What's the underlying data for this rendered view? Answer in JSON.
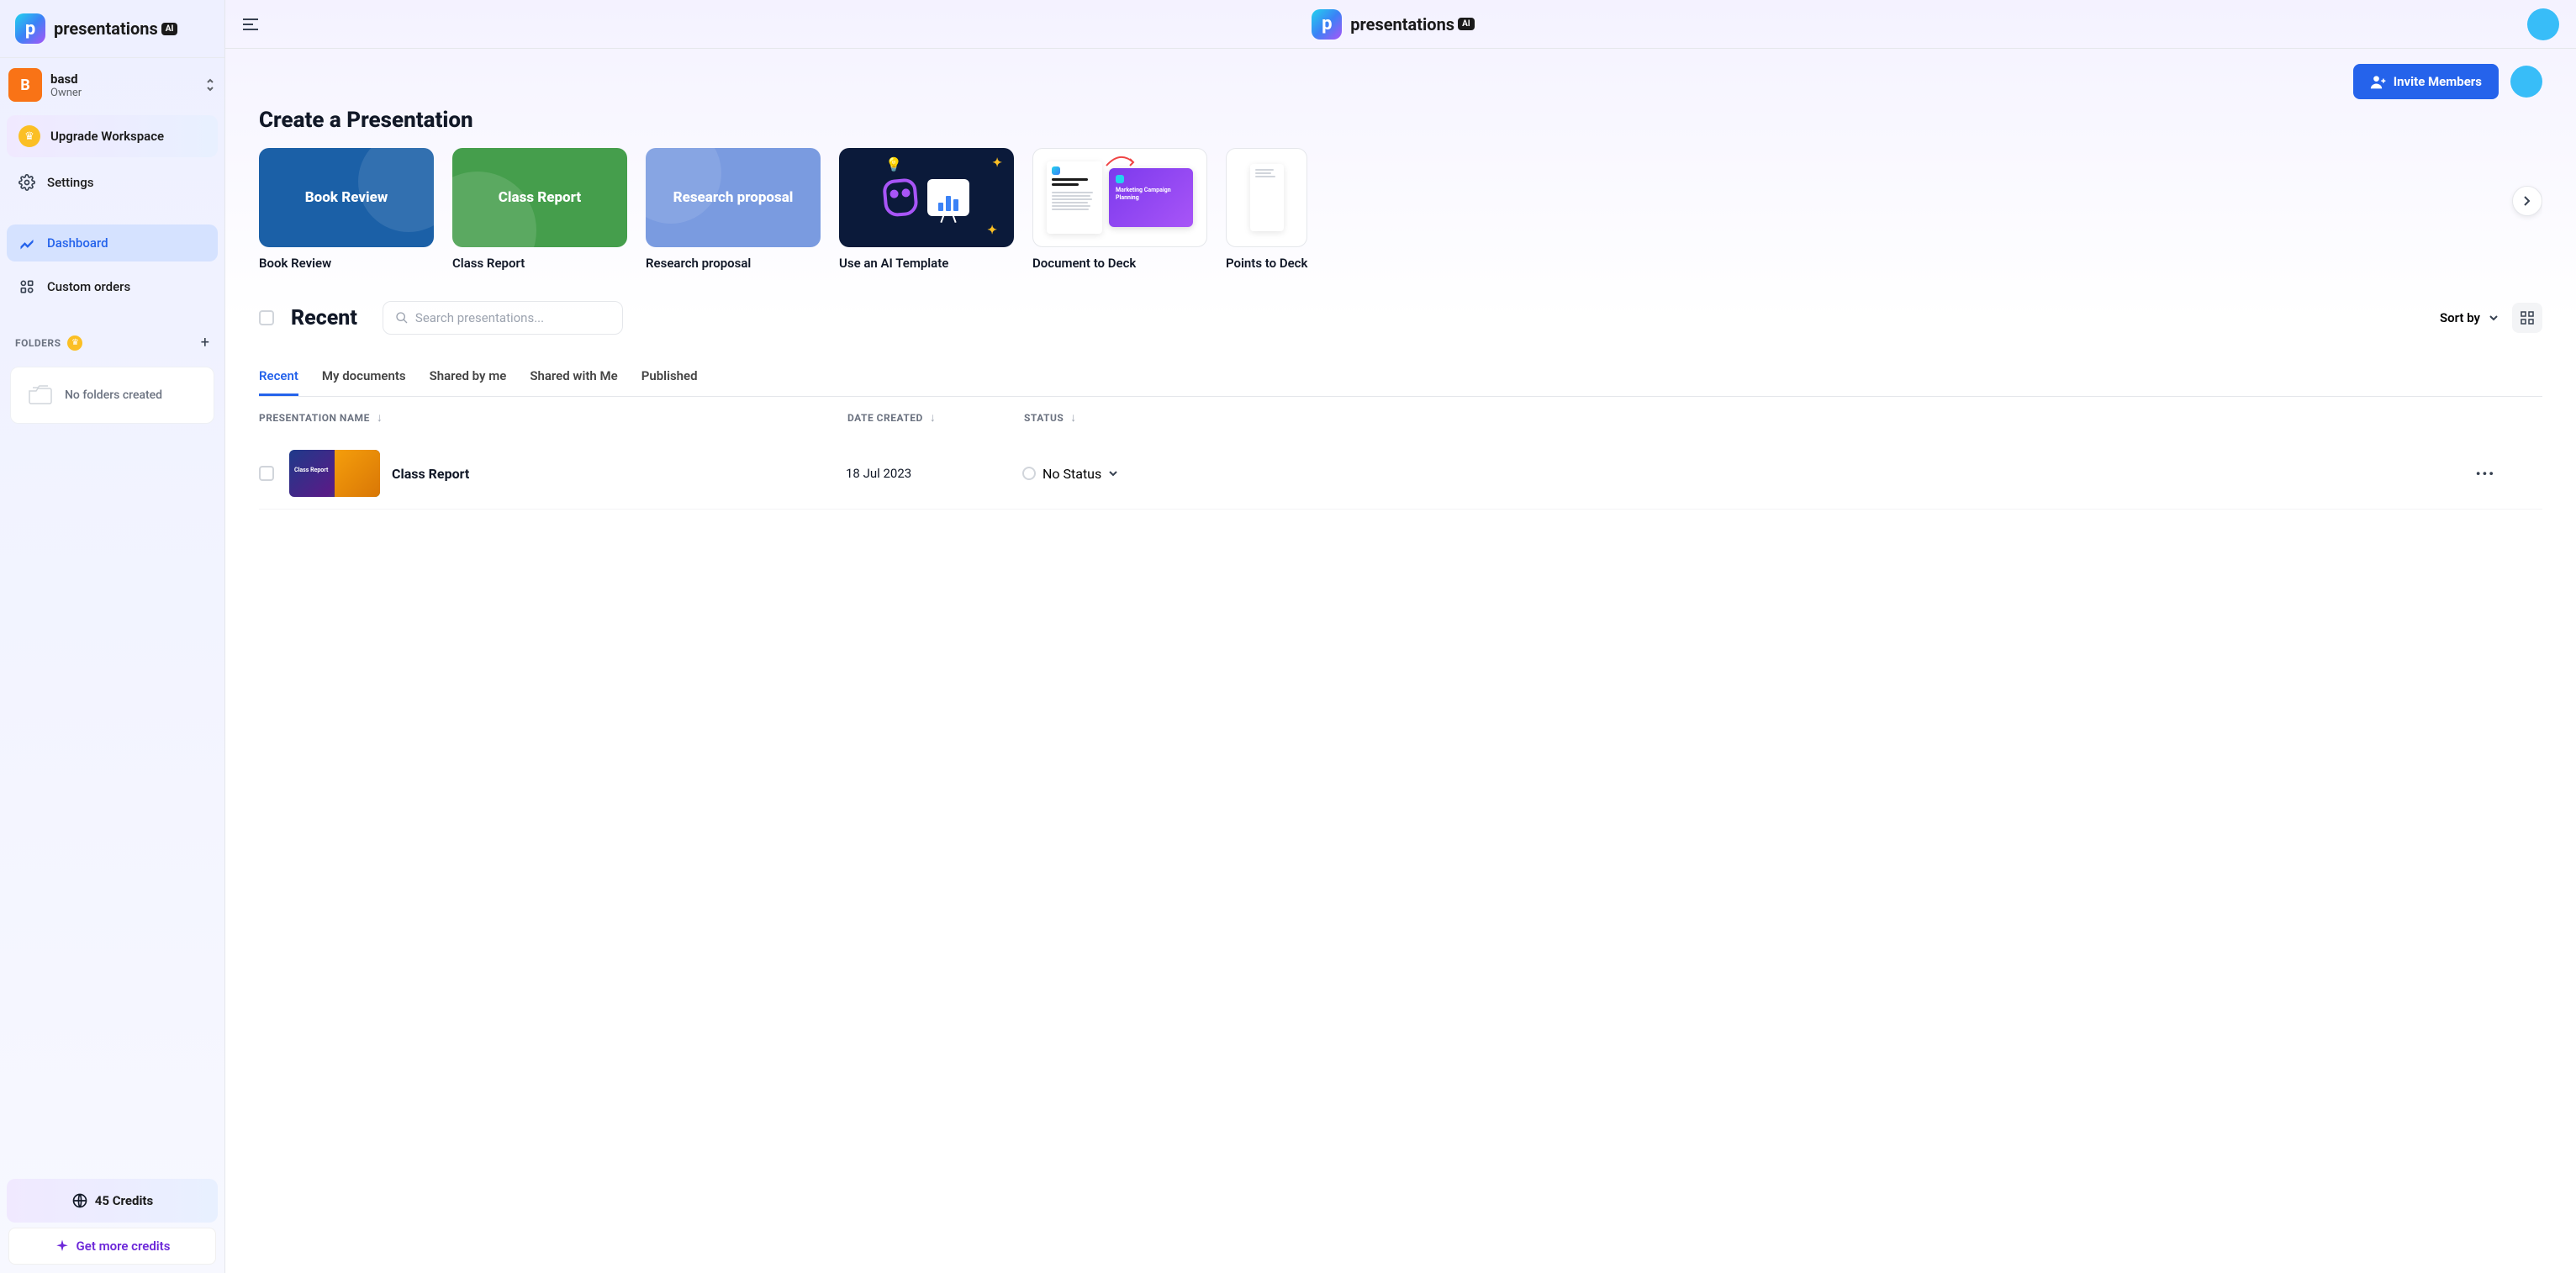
{
  "brand": {
    "name": "presentations",
    "ai_badge": "AI"
  },
  "workspace": {
    "initial": "B",
    "name": "basd",
    "role": "Owner"
  },
  "sidebar": {
    "upgrade": "Upgrade Workspace",
    "settings": "Settings",
    "dashboard": "Dashboard",
    "custom_orders": "Custom orders",
    "folders_label": "FOLDERS",
    "folders_empty": "No folders created"
  },
  "credits": {
    "label": "45 Credits",
    "get_more": "Get more credits"
  },
  "header": {
    "invite": "Invite Members"
  },
  "create": {
    "title": "Create a Presentation",
    "cards": [
      {
        "title": "Book Review",
        "label": "Book Review"
      },
      {
        "title": "Class Report",
        "label": "Class Report"
      },
      {
        "title": "Research proposal",
        "label": "Research proposal"
      },
      {
        "title": "",
        "label": "Use an AI Template"
      },
      {
        "title": "",
        "label": "Document to Deck",
        "deck_title": "Marketing Campaign Planning",
        "doc_title": "Marketing Campaign Planning"
      },
      {
        "title": "",
        "label": "Points to Deck"
      }
    ]
  },
  "recent": {
    "title": "Recent",
    "search_placeholder": "Search presentations...",
    "sort_label": "Sort by",
    "tabs": [
      "Recent",
      "My documents",
      "Shared by me",
      "Shared with Me",
      "Published"
    ],
    "columns": {
      "name": "PRESENTATION NAME",
      "date": "DATE CREATED",
      "status": "STATUS"
    },
    "rows": [
      {
        "name": "Class Report",
        "date": "18 Jul 2023",
        "status": "No Status"
      }
    ]
  }
}
